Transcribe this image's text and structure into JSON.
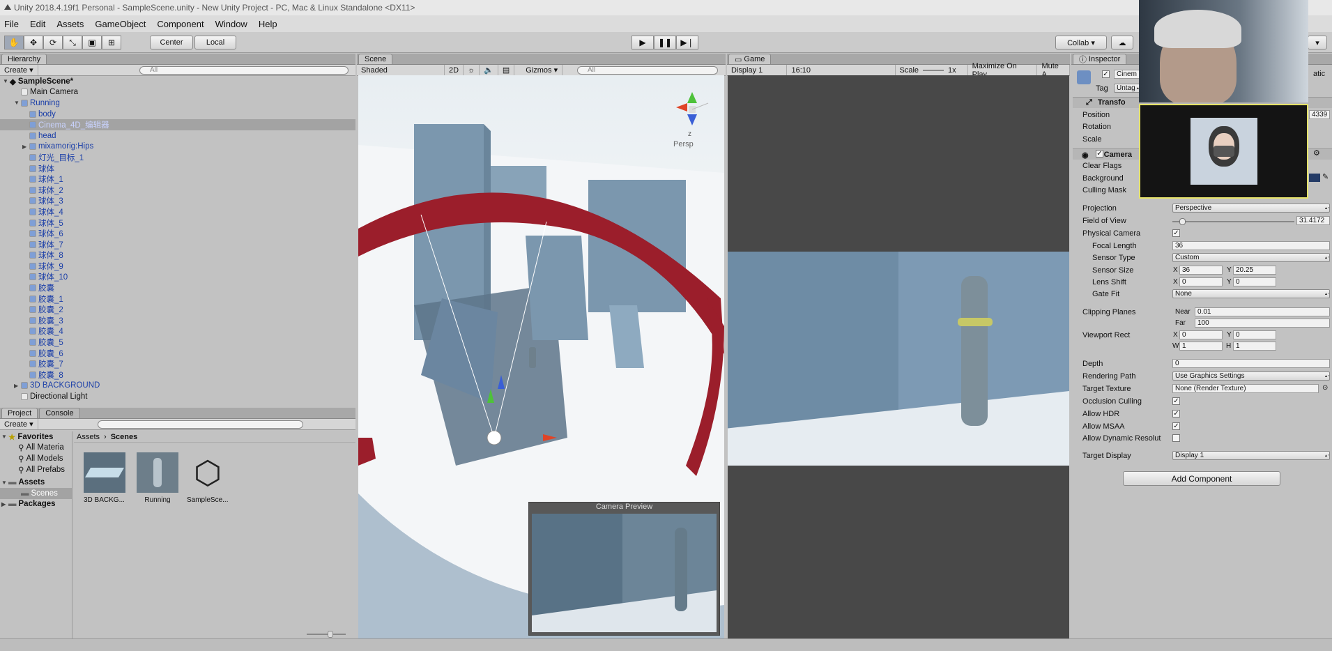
{
  "window": {
    "title": "Unity 2018.4.19f1 Personal - SampleScene.unity - New Unity Project - PC, Mac & Linux Standalone <DX11>"
  },
  "menu": [
    "File",
    "Edit",
    "Assets",
    "GameObject",
    "Component",
    "Window",
    "Help"
  ],
  "toolbar": {
    "center_label": "Center",
    "local_label": "Local",
    "collab_label": "Collab ▾",
    "cloud_icon": "cloud-icon",
    "tools": [
      "hand-icon",
      "move-icon",
      "rotate-icon",
      "scale-icon",
      "rect-icon",
      "transform-icon"
    ]
  },
  "hierarchy": {
    "tab": "Hierarchy",
    "create": "Create ▾",
    "search_placeholder": "All",
    "scene": "SampleScene*",
    "items": [
      {
        "label": "Main Camera",
        "indent": 1,
        "blue": false
      },
      {
        "label": "Running",
        "indent": 1,
        "blue": true,
        "arrow": "▼"
      },
      {
        "label": "body",
        "indent": 2,
        "blue": true
      },
      {
        "label": "Cinema_4D_编辑器",
        "indent": 2,
        "blue": true,
        "sel": true
      },
      {
        "label": "head",
        "indent": 2,
        "blue": true
      },
      {
        "label": "mixamorig:Hips",
        "indent": 2,
        "blue": true,
        "arrow": "▶"
      },
      {
        "label": "灯光_目标_1",
        "indent": 2,
        "blue": true
      },
      {
        "label": "球体",
        "indent": 2,
        "blue": true
      },
      {
        "label": "球体_1",
        "indent": 2,
        "blue": true
      },
      {
        "label": "球体_2",
        "indent": 2,
        "blue": true
      },
      {
        "label": "球体_3",
        "indent": 2,
        "blue": true
      },
      {
        "label": "球体_4",
        "indent": 2,
        "blue": true
      },
      {
        "label": "球体_5",
        "indent": 2,
        "blue": true
      },
      {
        "label": "球体_6",
        "indent": 2,
        "blue": true
      },
      {
        "label": "球体_7",
        "indent": 2,
        "blue": true
      },
      {
        "label": "球体_8",
        "indent": 2,
        "blue": true
      },
      {
        "label": "球体_9",
        "indent": 2,
        "blue": true
      },
      {
        "label": "球体_10",
        "indent": 2,
        "blue": true
      },
      {
        "label": "胶囊",
        "indent": 2,
        "blue": true
      },
      {
        "label": "胶囊_1",
        "indent": 2,
        "blue": true
      },
      {
        "label": "胶囊_2",
        "indent": 2,
        "blue": true
      },
      {
        "label": "胶囊_3",
        "indent": 2,
        "blue": true
      },
      {
        "label": "胶囊_4",
        "indent": 2,
        "blue": true
      },
      {
        "label": "胶囊_5",
        "indent": 2,
        "blue": true
      },
      {
        "label": "胶囊_6",
        "indent": 2,
        "blue": true
      },
      {
        "label": "胶囊_7",
        "indent": 2,
        "blue": true
      },
      {
        "label": "胶囊_8",
        "indent": 2,
        "blue": true
      },
      {
        "label": "3D BACKGROUND",
        "indent": 1,
        "blue": true,
        "arrow": "▶"
      },
      {
        "label": "Directional Light",
        "indent": 1,
        "blue": false
      }
    ]
  },
  "project": {
    "tab": "Project",
    "console_tab": "Console",
    "create": "Create ▾",
    "favorites": {
      "label": "Favorites",
      "items": [
        "All Materia",
        "All Models",
        "All Prefabs"
      ]
    },
    "assets": "Assets",
    "scenes": "Scenes",
    "packages": "Packages",
    "breadcrumb": [
      "Assets",
      "Scenes"
    ],
    "files": [
      "3D BACKG...",
      "Running",
      "SampleSce..."
    ]
  },
  "scene": {
    "tab": "Scene",
    "shading": "Shaded",
    "mode2d": "2D",
    "gizmos": "Gizmos ▾",
    "search_placeholder": "All",
    "persp": "Persp",
    "axis_z": "z",
    "camera_preview": "Camera Preview"
  },
  "game": {
    "tab": "Game",
    "display": "Display 1",
    "aspect": "16:10",
    "scale_label": "Scale",
    "scale_value": "1x",
    "maximize": "Maximize On Play",
    "mute": "Mute A"
  },
  "inspector": {
    "tab": "Inspector",
    "name": "Cinem",
    "tag_label": "Tag",
    "tag_value": "Untag",
    "static_label": "atic",
    "transform": {
      "title": "Transfo",
      "position": "Position",
      "rotation": "Rotation",
      "scale": "Scale",
      "pos_tail": "4339"
    },
    "camera": {
      "title": "Camera",
      "clear_flags": "Clear Flags",
      "background": "Background",
      "culling_mask": "Culling Mask",
      "projection": "Projection",
      "projection_value": "Perspective",
      "fov": "Field of View",
      "fov_value": "31.4172",
      "fov_slider": 0.06,
      "physical": "Physical Camera",
      "focal": "Focal Length",
      "focal_value": "36",
      "sensor_type": "Sensor Type",
      "sensor_type_value": "Custom",
      "sensor_size": "Sensor Size",
      "sensor_x": "36",
      "sensor_y": "20.25",
      "lens_shift": "Lens Shift",
      "lens_x": "0",
      "lens_y": "0",
      "gate_fit": "Gate Fit",
      "gate_fit_value": "None",
      "clipping": "Clipping Planes",
      "near_label": "Near",
      "near": "0.01",
      "far_label": "Far",
      "far": "100",
      "viewport": "Viewport Rect",
      "vx": "0",
      "vy": "0",
      "vw": "1",
      "vh": "1",
      "depth": "Depth",
      "depth_value": "0",
      "rendering_path": "Rendering Path",
      "rendering_path_value": "Use Graphics Settings",
      "target_texture": "Target Texture",
      "target_texture_value": "None (Render Texture)",
      "occlusion": "Occlusion Culling",
      "hdr": "Allow HDR",
      "msaa": "Allow MSAA",
      "dyn_res": "Allow Dynamic Resolut",
      "target_display": "Target Display",
      "target_display_value": "Display 1"
    },
    "add_component": "Add Component",
    "letters": {
      "x": "X",
      "y": "Y",
      "w": "W",
      "h": "H"
    }
  }
}
